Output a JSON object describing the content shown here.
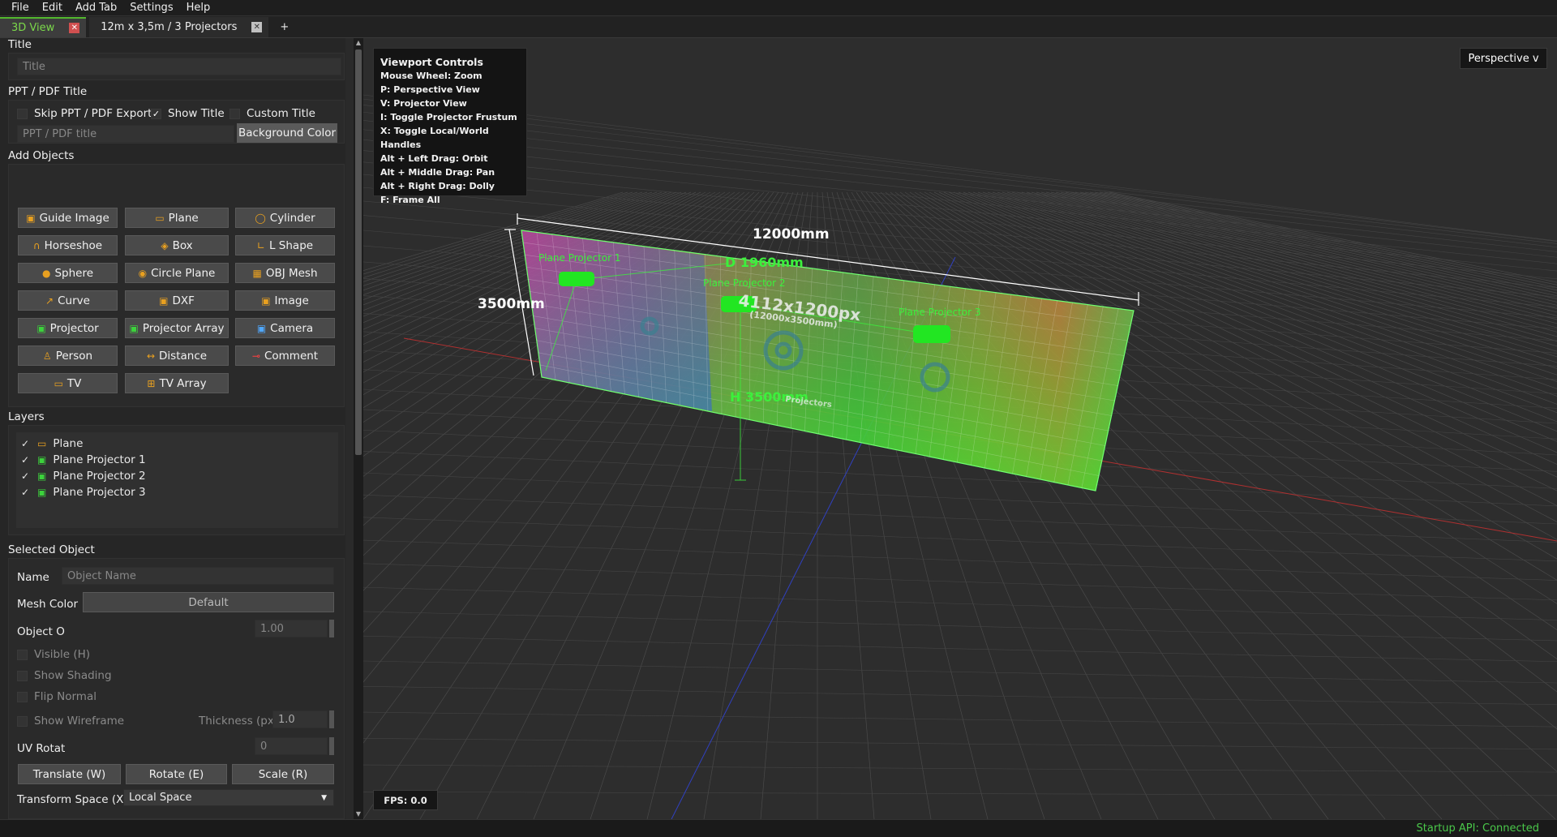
{
  "menu": [
    "File",
    "Edit",
    "Add Tab",
    "Settings",
    "Help"
  ],
  "tabs": [
    {
      "label": "3D View",
      "active": true
    },
    {
      "label": "12m x 3,5m / 3 Projectors",
      "active": false
    }
  ],
  "tab_add": "+",
  "panel": {
    "title_section": "Title",
    "title_placeholder": "Title",
    "ppt_section": "PPT / PDF Title",
    "skip_ppt": "Skip PPT / PDF Export",
    "show_title": "Show Title",
    "custom_title": "Custom Title",
    "ppt_placeholder": "PPT / PDF title",
    "background_color": "Background Color",
    "add_objects_section": "Add Objects",
    "add_objects": [
      {
        "label": "Guide Image",
        "icon": "image-icon"
      },
      {
        "label": "Plane",
        "icon": "plane-icon"
      },
      {
        "label": "Cylinder",
        "icon": "cylinder-icon"
      },
      {
        "label": "Horseshoe",
        "icon": "horseshoe-icon"
      },
      {
        "label": "Box",
        "icon": "box-icon"
      },
      {
        "label": "L Shape",
        "icon": "l-shape-icon"
      },
      {
        "label": "Sphere",
        "icon": "sphere-icon"
      },
      {
        "label": "Circle Plane",
        "icon": "circle-plane-icon"
      },
      {
        "label": "OBJ Mesh",
        "icon": "obj-mesh-icon"
      },
      {
        "label": "Curve",
        "icon": "curve-icon"
      },
      {
        "label": "DXF",
        "icon": "dxf-icon"
      },
      {
        "label": "Image",
        "icon": "image-icon"
      },
      {
        "label": "Projector",
        "icon": "projector-icon"
      },
      {
        "label": "Projector Array",
        "icon": "projector-array-icon"
      },
      {
        "label": "Camera",
        "icon": "camera-icon"
      },
      {
        "label": "Person",
        "icon": "person-icon"
      },
      {
        "label": "Distance",
        "icon": "distance-icon"
      },
      {
        "label": "Comment",
        "icon": "comment-icon"
      },
      {
        "label": "TV",
        "icon": "tv-icon"
      },
      {
        "label": "TV Array",
        "icon": "tv-array-icon"
      }
    ],
    "layers_section": "Layers",
    "layers": [
      {
        "label": "Plane",
        "icon": "plane-icon"
      },
      {
        "label": "Plane Projector 1",
        "icon": "projector-icon"
      },
      {
        "label": "Plane Projector 2",
        "icon": "projector-icon"
      },
      {
        "label": "Plane Projector 3",
        "icon": "projector-icon"
      }
    ],
    "selected_section": "Selected Object",
    "name_label": "Name",
    "name_placeholder": "Object Name",
    "mesh_color_label": "Mesh Color",
    "mesh_color_value": "Default",
    "opacity_label": "Object O",
    "opacity_value": "1.00",
    "visible": "Visible (H)",
    "show_shading": "Show Shading",
    "flip_normal": "Flip Normal",
    "show_wireframe": "Show Wireframe",
    "thickness_label": "Thickness (px)",
    "thickness_value": "1.0",
    "uv_rotation_label": "UV Rotat",
    "uv_rotation_value": "0",
    "translate": "Translate (W)",
    "rotate": "Rotate (E)",
    "scale": "Scale (R)",
    "transform_space_label": "Transform Space (X)",
    "transform_space_value": "Local Space"
  },
  "viewport": {
    "help_title": "Viewport Controls",
    "help_lines": [
      "Mouse Wheel: Zoom",
      "P: Perspective View",
      "V: Projector View",
      "I: Toggle Projector Frustum",
      "X: Toggle Local/World Handles",
      "Alt + Left Drag: Orbit",
      "Alt + Middle Drag: Pan",
      "Alt + Right Drag: Dolly",
      "F: Frame All"
    ],
    "view_mode": "Perspective v",
    "fps": "FPS: 0.0",
    "width_dim": "12000mm",
    "height_dim": "3500mm",
    "distance_dim": "D 1960mm",
    "height_marker": "H 3500mm",
    "resolution": "4112x1200px",
    "size_mm": "(12000x3500mm)",
    "projectors_text": "Projectors",
    "projector_labels": [
      "Plane Projector 1",
      "Plane Projector 2",
      "Plane Projector 3"
    ]
  },
  "status": "Startup API: Connected",
  "colors": {
    "accent_green": "#3cd23c",
    "status_green": "#4ac84a",
    "tab_green": "#7bd84a"
  }
}
